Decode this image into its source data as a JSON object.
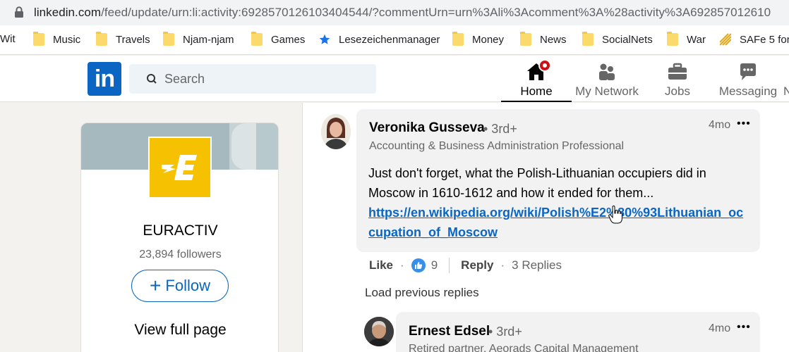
{
  "browser": {
    "url_host": "linkedin.com",
    "url_path": "/feed/update/urn:li:activity:6928570126103404544/?commentUrn=urn%3Ali%3Acomment%3A%28activity%3A692857012610",
    "bookmarks": [
      {
        "label": "Wit",
        "icon": "none"
      },
      {
        "label": "Music",
        "icon": "folder-icon"
      },
      {
        "label": "Travels",
        "icon": "folder-icon"
      },
      {
        "label": "Njam-njam",
        "icon": "folder-icon"
      },
      {
        "label": "Games",
        "icon": "folder-icon"
      },
      {
        "label": "Lesezeichenmanager",
        "icon": "star-icon"
      },
      {
        "label": "Money",
        "icon": "folder-icon"
      },
      {
        "label": "News",
        "icon": "folder-icon"
      },
      {
        "label": "SocialNets",
        "icon": "folder-icon"
      },
      {
        "label": "War",
        "icon": "folder-icon"
      },
      {
        "label": "SAFe 5 for",
        "icon": "stripes-icon"
      }
    ]
  },
  "header": {
    "logo_text": "in",
    "search_placeholder": "Search",
    "nav": [
      {
        "label": "Home",
        "icon": "home-icon",
        "active": true
      },
      {
        "label": "My Network",
        "icon": "network-icon"
      },
      {
        "label": "Jobs",
        "icon": "briefcase-icon"
      },
      {
        "label": "Messaging",
        "icon": "messaging-icon"
      },
      {
        "label": "N",
        "icon": "none"
      }
    ]
  },
  "company": {
    "name": "EURACTIV",
    "followers": "23,894 followers",
    "follow_label": "Follow",
    "follow_plus": "+",
    "view_full_page": "View full page"
  },
  "comment": {
    "author": "Veronika Gusseva",
    "degree": "• 3rd+",
    "headline": "Accounting & Business Administration Professional",
    "time": "4mo",
    "more": "•••",
    "text": "Just don't forget, what the Polish-Lithuanian occupiers did in Moscow in 1610-1612 and how it ended for them...",
    "link": "https://en.wikipedia.org/wiki/Polish%E2%80%93Lithuanian_occupation_of_Moscow",
    "actions": {
      "like": "Like",
      "like_count": "9",
      "reply": "Reply",
      "replies": "3 Replies",
      "dot": "·"
    }
  },
  "load_previous": "Load previous replies",
  "reply": {
    "author": "Ernest Edsel",
    "degree": "• 3rd+",
    "headline": "Retired partner, Aeorads Capital Management",
    "time": "4mo",
    "more": "•••"
  },
  "colors": {
    "accent": "#0a66c2",
    "badge": "#cc1016",
    "logo_bg": "#f6c100"
  }
}
